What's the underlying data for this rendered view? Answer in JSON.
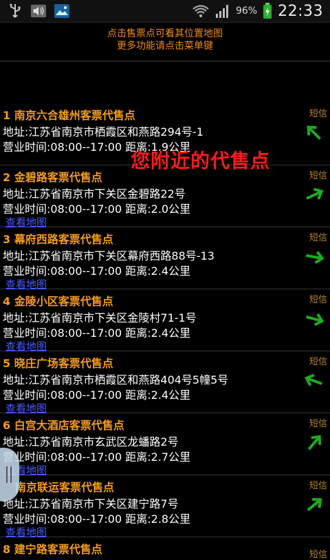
{
  "status_bar": {
    "battery_percent": "96%",
    "time": "22:33",
    "icons": [
      "usb-icon",
      "volume-icon",
      "image-icon",
      "wifi-icon",
      "signal-icon",
      "battery-charging-icon"
    ]
  },
  "hint": {
    "line1": "点击售票点可看其位置地图",
    "line2": "更多功能请点击菜单键"
  },
  "overlay_text": "您附近的代售点",
  "items": [
    {
      "title": "1 南京六合雄州客票代售点",
      "address": "地址:江苏省南京市栖霞区和燕路294号-1",
      "hours": "营业时间:08:00--17:00 距离:1.9公里",
      "link": "查看地图",
      "sms": "短信"
    },
    {
      "title": "2 金碧路客票代售点",
      "address": "地址:江苏省南京市下关区金碧路22号",
      "hours": "营业时间:08:00--17:00 距离:2.0公里",
      "link": "查看地图",
      "sms": "短信"
    },
    {
      "title": "3 幕府西路客票代售点",
      "address": "地址:江苏省南京市下关区幕府西路88号-13",
      "hours": "营业时间:08:00--17:00 距离:2.4公里",
      "link": "查看地图",
      "sms": "短信"
    },
    {
      "title": "4 金陵小区客票代售点",
      "address": "地址:江苏省南京市下关区金陵村71-1号",
      "hours": "营业时间:08:00--17:00 距离:2.4公里",
      "link": "查看地图",
      "sms": "短信"
    },
    {
      "title": "5 晓庄广场客票代售点",
      "address": "地址:江苏省南京市栖霞区和燕路404号5幢5号",
      "hours": "营业时间:08:00--17:00 距离:2.4公里",
      "link": "查看地图",
      "sms": "短信"
    },
    {
      "title": "6 白宫大酒店客票代售点",
      "address": "地址:江苏省南京市玄武区龙蟠路2号",
      "hours": "营业时间:08:00--17:00 距离:2.7公里",
      "link": "查看地图",
      "sms": "短信"
    },
    {
      "title": "南京联运客票代售点",
      "address": "地址:江苏省南京市下关区建宁路7号",
      "hours": "营业时间:08:00--17:00 距离:2.8公里",
      "link": "查看地图",
      "sms": "短信"
    },
    {
      "title": "8 建宁路客票代售点",
      "address": "",
      "hours": "",
      "link": "",
      "sms": "短信"
    }
  ]
}
